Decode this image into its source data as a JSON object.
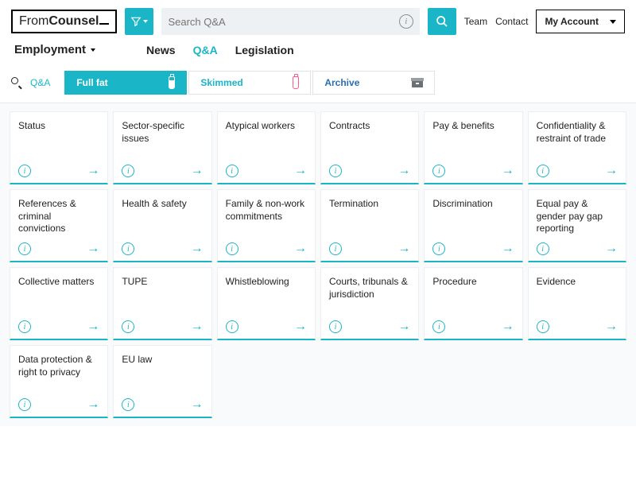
{
  "header": {
    "logo_thin": "From",
    "logo_bold": "Counsel",
    "search_placeholder": "Search Q&A",
    "links": {
      "team": "Team",
      "contact": "Contact"
    },
    "account_label": "My Account"
  },
  "nav": {
    "category": "Employment",
    "tabs": [
      {
        "label": "News",
        "active": false
      },
      {
        "label": "Q&A",
        "active": true
      },
      {
        "label": "Legislation",
        "active": false
      }
    ]
  },
  "breadcrumb": "Q&A",
  "view_tabs": [
    {
      "key": "full",
      "label": "Full fat"
    },
    {
      "key": "skimmed",
      "label": "Skimmed"
    },
    {
      "key": "archive",
      "label": "Archive"
    }
  ],
  "cards": [
    {
      "title": "Status"
    },
    {
      "title": "Sector-specific issues"
    },
    {
      "title": "Atypical workers"
    },
    {
      "title": "Contracts"
    },
    {
      "title": "Pay & benefits"
    },
    {
      "title": "Confidentiality & restraint of trade"
    },
    {
      "title": "References & criminal convictions"
    },
    {
      "title": "Health & safety"
    },
    {
      "title": "Family & non-work commitments"
    },
    {
      "title": "Termination"
    },
    {
      "title": "Discrimination"
    },
    {
      "title": "Equal pay & gender pay gap reporting"
    },
    {
      "title": "Collective matters"
    },
    {
      "title": "TUPE"
    },
    {
      "title": "Whistleblowing"
    },
    {
      "title": "Courts, tribunals & jurisdiction"
    },
    {
      "title": "Procedure"
    },
    {
      "title": "Evidence"
    },
    {
      "title": "Data protection & right to privacy"
    },
    {
      "title": "EU law"
    }
  ]
}
